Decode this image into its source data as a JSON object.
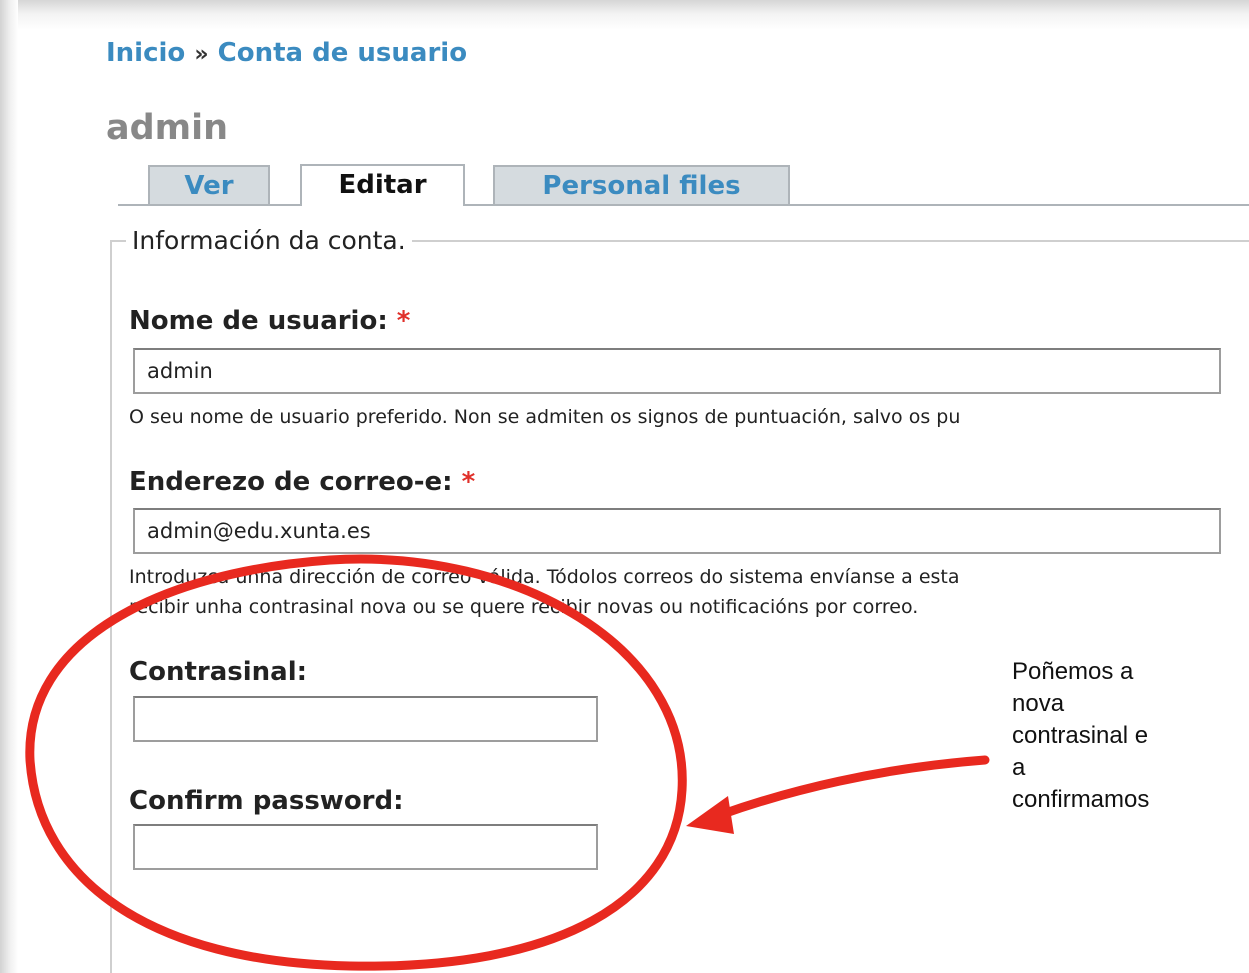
{
  "breadcrumb": {
    "home": "Inicio",
    "separator": "»",
    "current": "Conta de usuario"
  },
  "page_title": "admin",
  "tabs": [
    {
      "label": "Ver",
      "active": false
    },
    {
      "label": "Editar",
      "active": true
    },
    {
      "label": "Personal files",
      "active": false
    }
  ],
  "fieldset": {
    "legend": "Información da conta."
  },
  "fields": {
    "username": {
      "label": "Nome de usuario:",
      "required_mark": "*",
      "value": "admin",
      "description": "O seu nome de usuario preferido. Non se admiten os signos de puntuación, salvo os pu"
    },
    "email": {
      "label": "Enderezo de correo-e:",
      "required_mark": "*",
      "value": "admin@edu.xunta.es",
      "description_line1": "Introduzca unha dirección de correo válida. Tódolos correos do sistema envíanse a esta",
      "description_line2": "recibir unha contrasinal nova ou se quere recibir novas ou notificacións por correo."
    },
    "password": {
      "label": "Contrasinal:",
      "value": ""
    },
    "confirm_password": {
      "label": "Confirm password:",
      "value": ""
    }
  },
  "annotation": {
    "lines": [
      "Poñemos a",
      "nova",
      "contrasinal e",
      "a",
      "confirmamos"
    ],
    "color": "#e8291f"
  },
  "colors": {
    "link": "#3b8bc0",
    "tab_inactive_bg": "#d5dbdf",
    "required": "#e0302a",
    "title_gray": "#888888"
  }
}
